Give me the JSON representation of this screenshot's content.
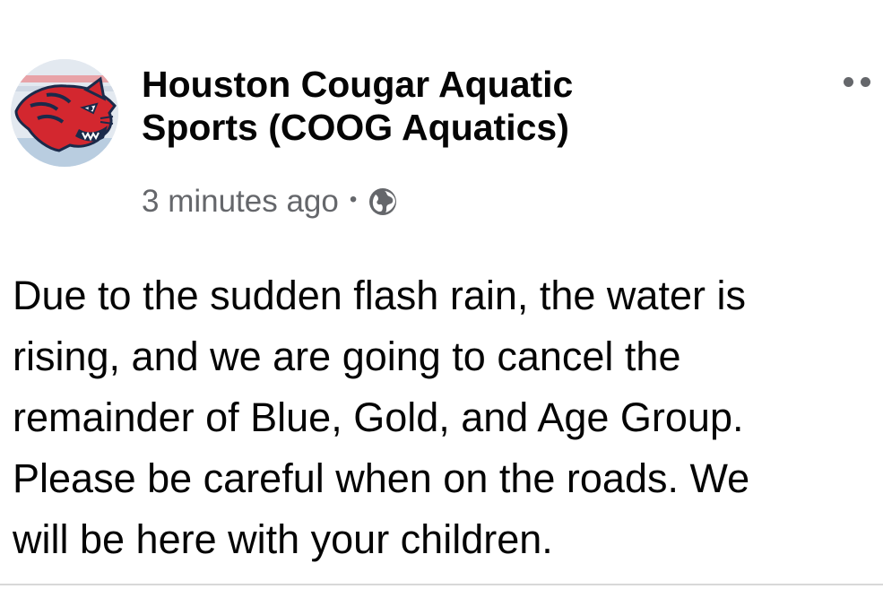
{
  "post": {
    "author": {
      "name_line1": "Houston Cougar Aquatic",
      "name_line2": "Sports (COOG Aquatics)",
      "avatar_icon": "cougar-logo-icon"
    },
    "timestamp": "3 minutes ago",
    "separator": "•",
    "audience_icon": "globe-icon",
    "menu_icon": "more-options-icon",
    "body": "Due to the sudden flash rain, the water is\nrising,  and we are going to cancel the\nremainder of Blue,  Gold,  and Age Group.\nPlease be careful when on the roads. We\nwill be here with your children."
  },
  "colors": {
    "name_text": "#050505",
    "meta_text": "#65676b",
    "logo_red": "#d3272f",
    "logo_navy": "#1b2a4a"
  }
}
